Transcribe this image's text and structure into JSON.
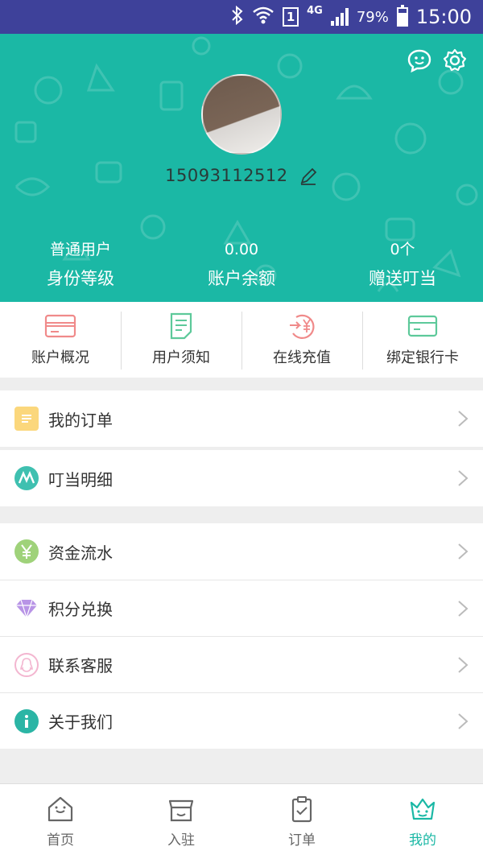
{
  "status_bar": {
    "icons": [
      "bluetooth-icon",
      "wifi-icon",
      "sim-icon",
      "signal-icon",
      "battery-icon"
    ],
    "sim": "1",
    "network": "4G",
    "battery": "79%",
    "time": "15:00"
  },
  "header": {
    "background_color": "#1bb8a5",
    "phone": "15093112512",
    "stats": [
      {
        "value": "普通用户",
        "label": "身份等级"
      },
      {
        "value": "0.00",
        "label": "账户余额"
      },
      {
        "value": "0个",
        "label": "赠送叮当"
      }
    ]
  },
  "quick_actions": [
    {
      "label": "账户概况",
      "icon": "card-icon"
    },
    {
      "label": "用户须知",
      "icon": "document-icon"
    },
    {
      "label": "在线充值",
      "icon": "yuan-recharge-icon"
    },
    {
      "label": "绑定银行卡",
      "icon": "bank-card-icon"
    }
  ],
  "menu_groups": [
    [
      {
        "label": "我的订单",
        "icon": "order-icon",
        "color": "#fbd77c"
      }
    ],
    [
      {
        "label": "叮当明细",
        "icon": "dingdang-icon",
        "color": "#3fc0b0"
      }
    ],
    [
      {
        "label": "资金流水",
        "icon": "yuan-icon",
        "color": "#9fd27a"
      },
      {
        "label": "积分兑换",
        "icon": "diamond-icon",
        "color": "#b894e6"
      },
      {
        "label": "联系客服",
        "icon": "qq-icon",
        "color": "#f3b6d0"
      },
      {
        "label": "关于我们",
        "icon": "info-icon",
        "color": "#2bb5a5"
      }
    ]
  ],
  "tabs": [
    {
      "label": "首页",
      "icon": "home-icon",
      "active": false
    },
    {
      "label": "入驻",
      "icon": "store-icon",
      "active": false
    },
    {
      "label": "订单",
      "icon": "clipboard-icon",
      "active": false
    },
    {
      "label": "我的",
      "icon": "crown-face-icon",
      "active": true
    }
  ],
  "accent_color": "#1bb8a5"
}
